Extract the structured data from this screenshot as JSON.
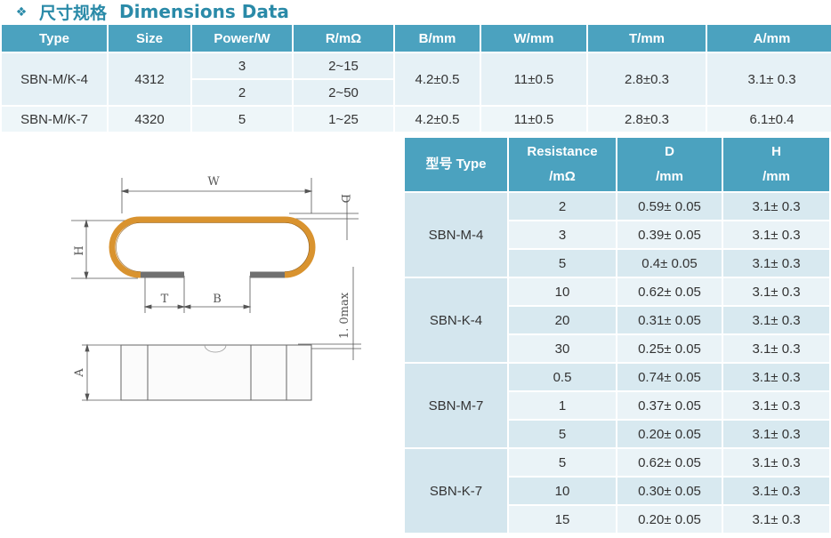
{
  "heading": {
    "bullet": "❖",
    "cn": "尺寸规格",
    "en": "Dimensions Data"
  },
  "table1": {
    "headers": [
      "Type",
      "Size",
      "Power/W",
      "R/mΩ",
      "B/mm",
      "W/mm",
      "T/mm",
      "A/mm"
    ],
    "rows": [
      {
        "type": "SBN-M/K-4",
        "size": "4312",
        "sub": [
          {
            "power": "3",
            "r": "2~15"
          },
          {
            "power": "2",
            "r": "2~50"
          }
        ],
        "b": "4.2±0.5",
        "w": "11±0.5",
        "t": "2.8±0.3",
        "a": "3.1± 0.3"
      },
      {
        "type": "SBN-M/K-7",
        "size": "4320",
        "sub": [
          {
            "power": "5",
            "r": "1~25"
          }
        ],
        "b": "4.2±0.5",
        "w": "11±0.5",
        "t": "2.8±0.3",
        "a": "6.1±0.4"
      }
    ]
  },
  "table2": {
    "headers": {
      "type": "型号 Type",
      "resistance_1": "Resistance",
      "resistance_2": "/mΩ",
      "d_1": "D",
      "d_2": "/mm",
      "h_1": "H",
      "h_2": "/mm"
    },
    "groups": [
      {
        "model": "SBN-M-4",
        "rows": [
          {
            "r": "2",
            "d": "0.59± 0.05",
            "h": "3.1± 0.3"
          },
          {
            "r": "3",
            "d": "0.39± 0.05",
            "h": "3.1± 0.3"
          },
          {
            "r": "5",
            "d": "0.4± 0.05",
            "h": "3.1± 0.3"
          }
        ]
      },
      {
        "model": "SBN-K-4",
        "rows": [
          {
            "r": "10",
            "d": "0.62± 0.05",
            "h": "3.1± 0.3"
          },
          {
            "r": "20",
            "d": "0.31± 0.05",
            "h": "3.1± 0.3"
          },
          {
            "r": "30",
            "d": "0.25± 0.05",
            "h": "3.1± 0.3"
          }
        ]
      },
      {
        "model": "SBN-M-7",
        "rows": [
          {
            "r": "0.5",
            "d": "0.74± 0.05",
            "h": "3.1± 0.3"
          },
          {
            "r": "1",
            "d": "0.37± 0.05",
            "h": "3.1± 0.3"
          },
          {
            "r": "5",
            "d": "0.20± 0.05",
            "h": "3.1± 0.3"
          }
        ]
      },
      {
        "model": "SBN-K-7",
        "rows": [
          {
            "r": "5",
            "d": "0.62± 0.05",
            "h": "3.1± 0.3"
          },
          {
            "r": "10",
            "d": "0.30± 0.05",
            "h": "3.1± 0.3"
          },
          {
            "r": "15",
            "d": "0.20± 0.05",
            "h": "3.1± 0.3"
          }
        ]
      }
    ]
  },
  "drawing": {
    "label_w": "W",
    "label_d": "D",
    "label_h": "H",
    "label_t": "T",
    "label_b": "B",
    "label_lmax": "1. 0max",
    "label_a": "A",
    "colors": {
      "body": "#d9932f",
      "terminal": "#707070",
      "line": "#555555"
    }
  }
}
